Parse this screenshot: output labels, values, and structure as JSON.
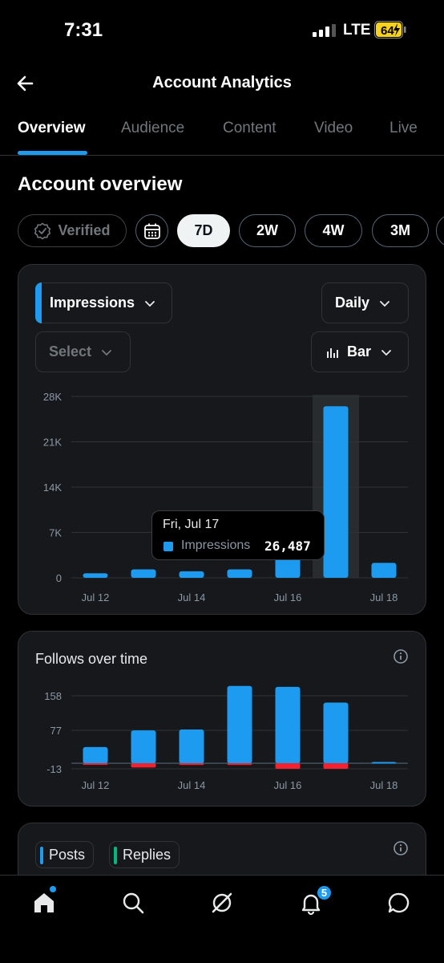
{
  "status": {
    "time": "7:31",
    "network": "LTE",
    "battery": "64"
  },
  "header": {
    "title": "Account Analytics"
  },
  "tabs": [
    {
      "label": "Overview",
      "active": true
    },
    {
      "label": "Audience"
    },
    {
      "label": "Content"
    },
    {
      "label": "Video"
    },
    {
      "label": "Live"
    }
  ],
  "section_title": "Account overview",
  "filters": {
    "verified": "Verified",
    "ranges": [
      "7D",
      "2W",
      "4W",
      "3M"
    ],
    "selected_range": "7D"
  },
  "impressions_card": {
    "metric": "Impressions",
    "interval": "Daily",
    "compare": "Select",
    "chart_type": "Bar",
    "tooltip": {
      "date": "Fri, Jul 17",
      "series": "Impressions",
      "value": "26,487"
    }
  },
  "follows_card": {
    "title": "Follows over time"
  },
  "posts_card": {
    "legend": [
      "Posts",
      "Replies"
    ]
  },
  "notifications_badge": "5",
  "colors": {
    "accent": "#1d9bf0",
    "negative": "#f4212e",
    "replies": "#00ba7c",
    "card_bg": "#16181c"
  },
  "chart_data": [
    {
      "type": "bar",
      "categories": [
        "Jul 12",
        "Jul 13",
        "Jul 14",
        "Jul 15",
        "Jul 16",
        "Jul 17",
        "Jul 18"
      ],
      "x_tick_labels": [
        "Jul 12",
        "Jul 14",
        "Jul 16",
        "Jul 18"
      ],
      "series": [
        {
          "name": "Impressions",
          "values": [
            700,
            1300,
            1000,
            1300,
            3400,
            26487,
            2300
          ]
        }
      ],
      "y_ticks": [
        "0",
        "7K",
        "14K",
        "21K",
        "28K"
      ],
      "ylim": [
        0,
        28000
      ],
      "highlighted_category": "Jul 17",
      "grid": true
    },
    {
      "type": "bar",
      "categories": [
        "Jul 12",
        "Jul 13",
        "Jul 14",
        "Jul 15",
        "Jul 16",
        "Jul 17",
        "Jul 18"
      ],
      "x_tick_labels": [
        "Jul 12",
        "Jul 14",
        "Jul 16",
        "Jul 18"
      ],
      "series": [
        {
          "values": [
            38,
            77,
            79,
            181,
            179,
            142,
            3
          ]
        },
        {
          "values": [
            -2,
            -10,
            -4,
            -4,
            -13,
            -13,
            0
          ]
        }
      ],
      "y_ticks": [
        "-13",
        "77",
        "158"
      ],
      "ylim": [
        -13,
        158
      ],
      "grid": true
    }
  ]
}
